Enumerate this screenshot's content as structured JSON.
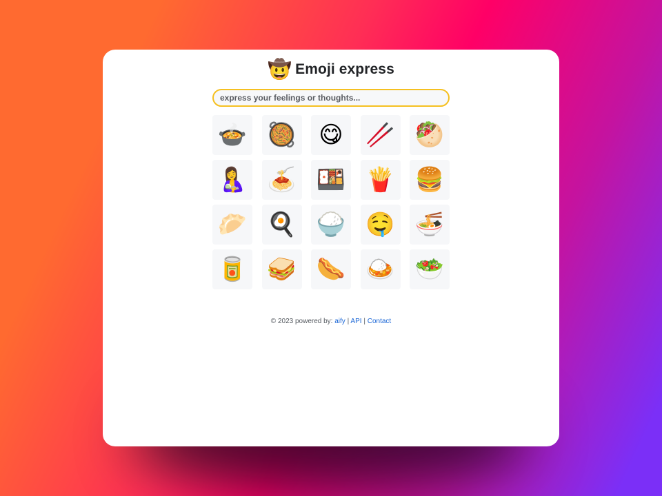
{
  "header": {
    "logo_emoji": "🤠",
    "title": "Emoji express"
  },
  "search": {
    "value": "",
    "placeholder": "express your feelings or thoughts..."
  },
  "emojis": [
    {
      "char": "🍲",
      "name": "pot-of-food"
    },
    {
      "char": "🥘",
      "name": "shallow-pan-of-food"
    },
    {
      "char": "😋",
      "name": "face-savoring-food"
    },
    {
      "char": "🥢",
      "name": "chopsticks"
    },
    {
      "char": "🥙",
      "name": "stuffed-flatbread"
    },
    {
      "char": "🤱",
      "name": "breast-feeding"
    },
    {
      "char": "🍝",
      "name": "spaghetti"
    },
    {
      "char": "🍱",
      "name": "bento-box"
    },
    {
      "char": "🍟",
      "name": "french-fries"
    },
    {
      "char": "🍔",
      "name": "hamburger"
    },
    {
      "char": "🥟",
      "name": "dumpling"
    },
    {
      "char": "🍳",
      "name": "cooking"
    },
    {
      "char": "🍚",
      "name": "cooked-rice"
    },
    {
      "char": "🤤",
      "name": "drooling-face"
    },
    {
      "char": "🍜",
      "name": "steaming-bowl"
    },
    {
      "char": "🥫",
      "name": "canned-food"
    },
    {
      "char": "🥪",
      "name": "sandwich"
    },
    {
      "char": "🌭",
      "name": "hot-dog"
    },
    {
      "char": "🍛",
      "name": "curry-rice"
    },
    {
      "char": "🥗",
      "name": "green-salad"
    }
  ],
  "footer": {
    "copyright": "© 2023 powered by:",
    "links": [
      {
        "label": "aify"
      },
      {
        "label": "API"
      },
      {
        "label": "Contact"
      }
    ],
    "separator": "|"
  }
}
